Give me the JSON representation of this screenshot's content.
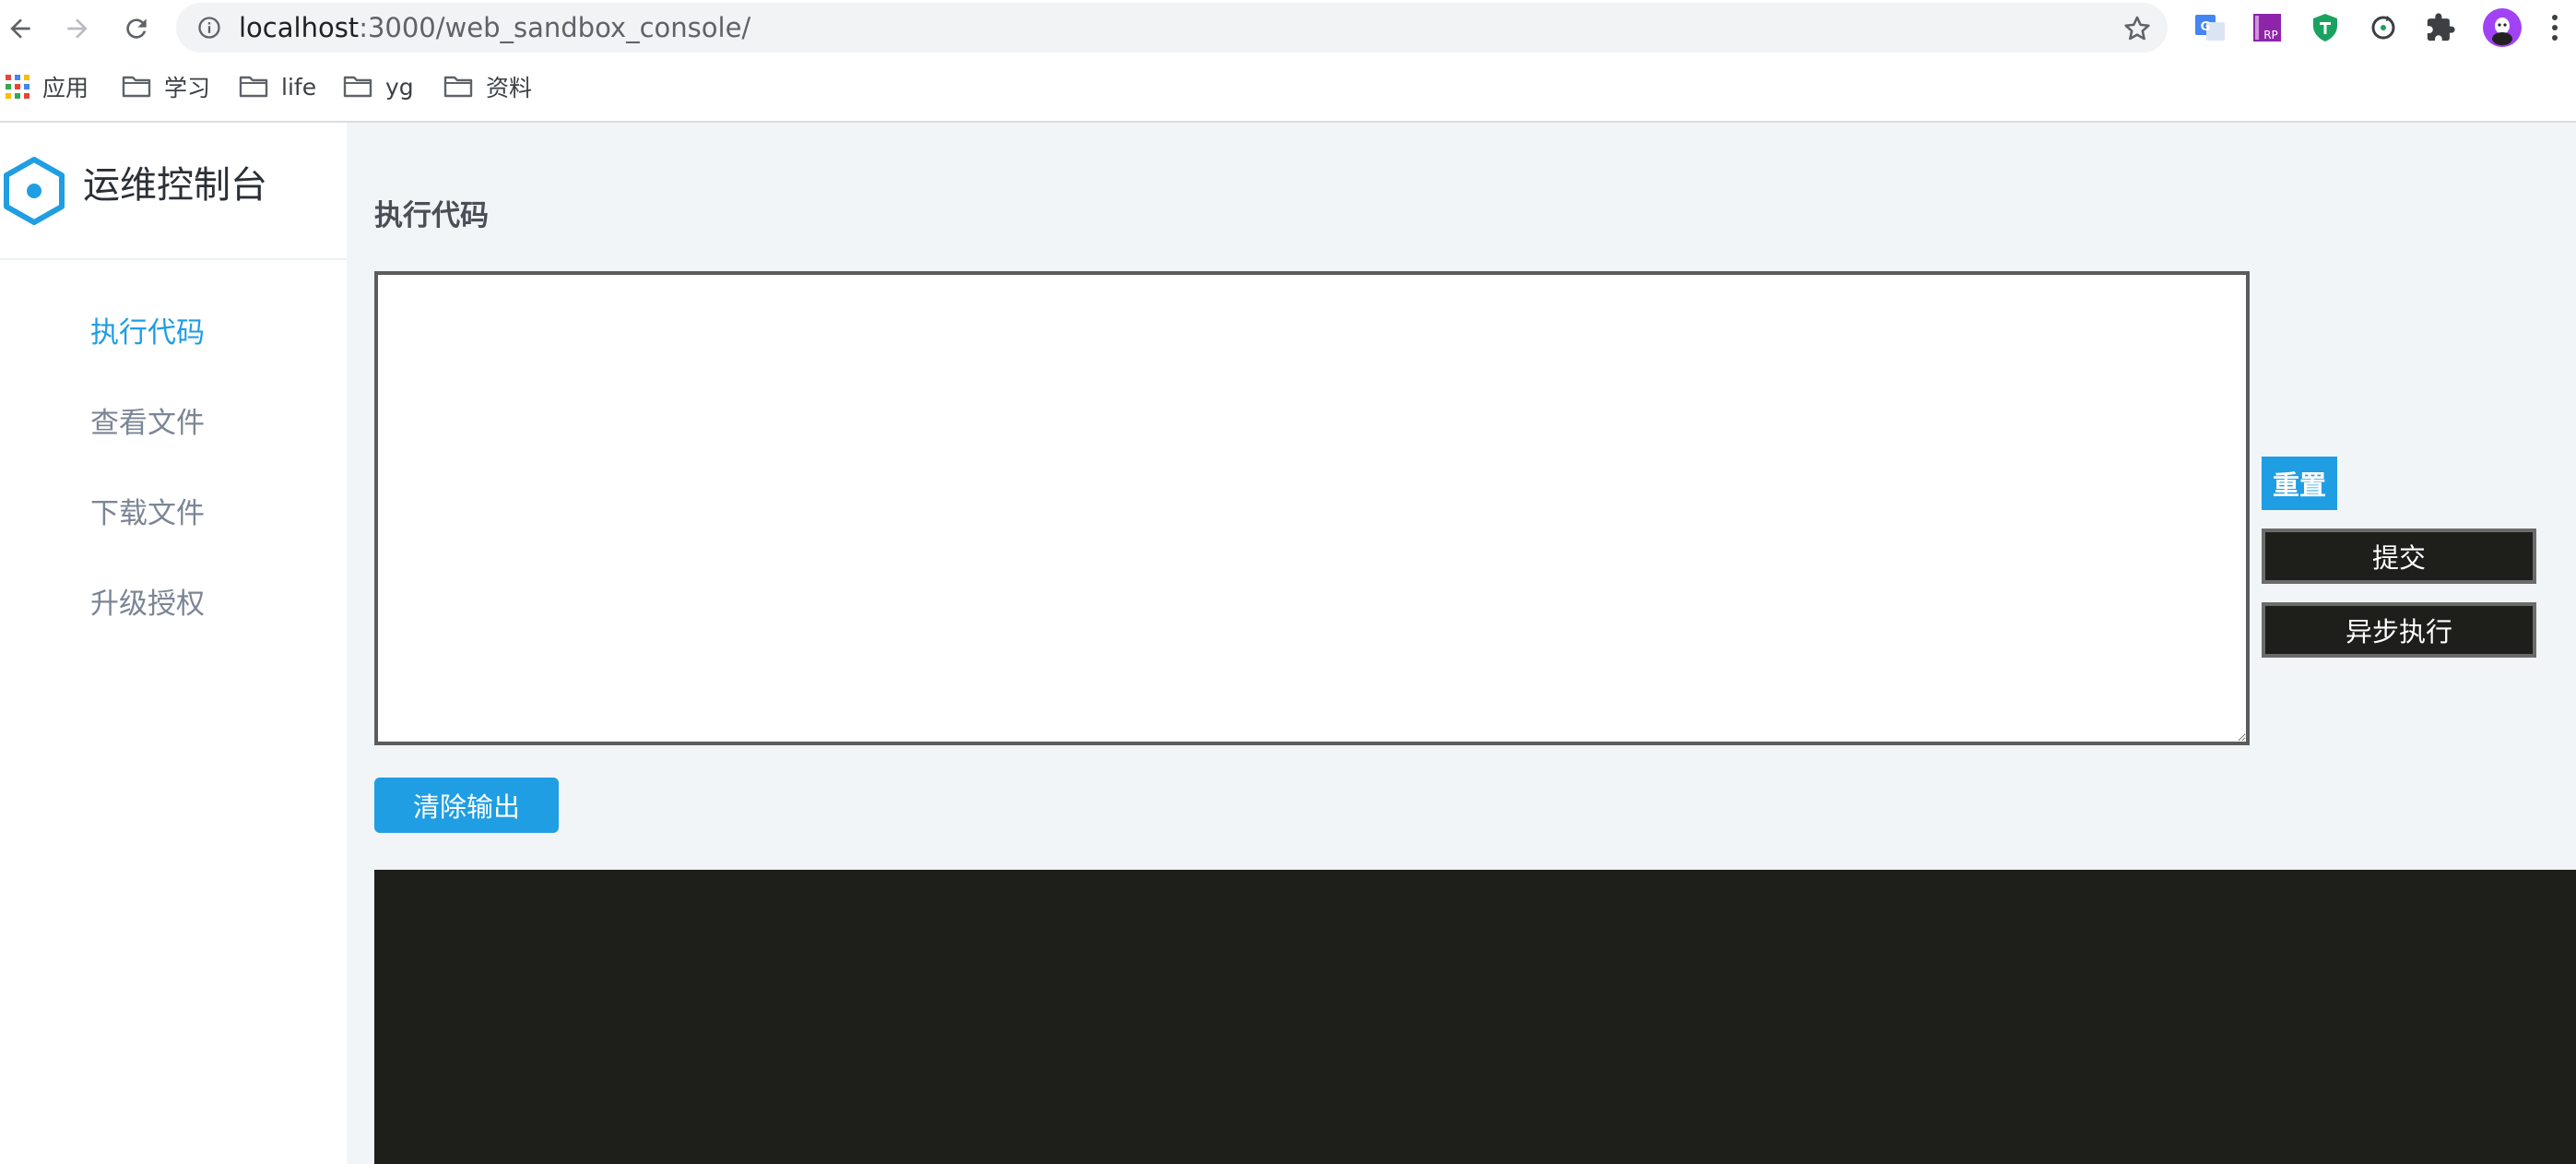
{
  "browser": {
    "url_host": "localhost",
    "url_rest": ":3000/web_sandbox_console/",
    "bookmarks": [
      {
        "label": "应用",
        "icon": "apps-grid-icon"
      },
      {
        "label": "学习",
        "icon": "folder-icon"
      },
      {
        "label": "life",
        "icon": "folder-icon"
      },
      {
        "label": "yg",
        "icon": "folder-icon"
      },
      {
        "label": "资料",
        "icon": "folder-icon"
      }
    ],
    "extensions": [
      "google-translate-icon",
      "rp-extension-icon",
      "shield-extension-icon",
      "refresh-extension-icon",
      "puzzle-extensions-icon",
      "profile-avatar-icon"
    ],
    "ext_rp_text": "RP",
    "ext_gt_text": "G"
  },
  "sidebar": {
    "app_title": "运维控制台",
    "items": [
      {
        "label": "执行代码",
        "active": true
      },
      {
        "label": "查看文件",
        "active": false
      },
      {
        "label": "下载文件",
        "active": false
      },
      {
        "label": "升级授权",
        "active": false
      }
    ]
  },
  "main": {
    "section_title": "执行代码",
    "code_value": "",
    "reset_label": "重置",
    "submit_label": "提交",
    "async_label": "异步执行",
    "clear_output_label": "清除输出",
    "output_text": ""
  },
  "colors": {
    "accent": "#1f9ee3",
    "dark_button": "#1e1e1b",
    "console_bg": "#1e1e1b",
    "page_bg": "#f2f5f8"
  }
}
